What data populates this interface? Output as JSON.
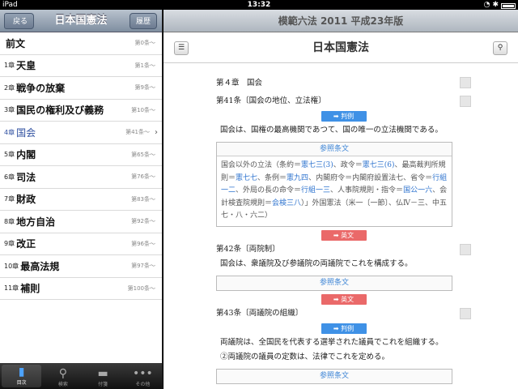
{
  "status_bar": {
    "device": "iPad",
    "time": "13:32"
  },
  "left": {
    "nav": {
      "back_label": "戻る",
      "title": "日本国憲法",
      "history_label": "履歴"
    },
    "toc": [
      {
        "num": "",
        "title": "前文",
        "article": "第0条〜",
        "selected": false
      },
      {
        "num": "1章",
        "title": "天皇",
        "article": "第1条〜",
        "selected": false
      },
      {
        "num": "2章",
        "title": "戦争の放棄",
        "article": "第9条〜",
        "selected": false
      },
      {
        "num": "3章",
        "title": "国民の権利及び義務",
        "article": "第10条〜",
        "selected": false
      },
      {
        "num": "4章",
        "title": "国会",
        "article": "第41条〜",
        "selected": true
      },
      {
        "num": "5章",
        "title": "内閣",
        "article": "第65条〜",
        "selected": false
      },
      {
        "num": "6章",
        "title": "司法",
        "article": "第76条〜",
        "selected": false
      },
      {
        "num": "7章",
        "title": "財政",
        "article": "第83条〜",
        "selected": false
      },
      {
        "num": "8章",
        "title": "地方自治",
        "article": "第92条〜",
        "selected": false
      },
      {
        "num": "9章",
        "title": "改正",
        "article": "第96条〜",
        "selected": false
      },
      {
        "num": "10章",
        "title": "最高法規",
        "article": "第97条〜",
        "selected": false
      },
      {
        "num": "11章",
        "title": "補則",
        "article": "第100条〜",
        "selected": false
      }
    ],
    "tabs": [
      {
        "label": "目次",
        "icon": "book-icon",
        "active": true
      },
      {
        "label": "検索",
        "icon": "magnifier-icon",
        "active": false
      },
      {
        "label": "付箋",
        "icon": "sticky-note-icon",
        "active": false
      },
      {
        "label": "その他",
        "icon": "more-dots-icon",
        "active": false
      }
    ]
  },
  "right": {
    "header_title": "模範六法 2011 平成23年版",
    "doc_title": "日本国憲法",
    "chapter": "第４章　国会",
    "art41": {
      "heading": "第41条〔国会の地位、立法権〕",
      "case_label": "➡ 判例",
      "text": "国会は、国権の最高機関であつて、国の唯一の立法機関である。",
      "ref_head": "参照条文",
      "ref_parts": [
        {
          "t": "国会以外の立法（条約＝",
          "l": false
        },
        {
          "t": "憲七三(3)",
          "l": true
        },
        {
          "t": "、政令＝",
          "l": false
        },
        {
          "t": "憲七三(6)",
          "l": true
        },
        {
          "t": "、最高裁判所規則＝",
          "l": false
        },
        {
          "t": "憲七七",
          "l": true
        },
        {
          "t": "、条例＝",
          "l": false
        },
        {
          "t": "憲九四",
          "l": true
        },
        {
          "t": "、内閣府令＝内閣府設置法七、省令＝",
          "l": false
        },
        {
          "t": "行組一二",
          "l": true
        },
        {
          "t": "、外局の長の命令＝",
          "l": false
        },
        {
          "t": "行組一三",
          "l": true
        },
        {
          "t": "、人事院規則・指令＝",
          "l": false
        },
        {
          "t": "国公一六",
          "l": true
        },
        {
          "t": "、会計検査院規則＝",
          "l": false
        },
        {
          "t": "会検三八",
          "l": true
        },
        {
          "t": "）」外国憲法（米一〔一節〕、仏Ⅳ－三、中五七・八・六二）",
          "l": false
        }
      ],
      "english_label": "➡ 英文"
    },
    "art42": {
      "heading": "第42条〔両院制〕",
      "text": "国会は、衆議院及び参議院の両議院でこれを構成する。",
      "ref_head": "参照条文",
      "english_label": "➡ 英文"
    },
    "art43": {
      "heading": "第43条〔両議院の組織〕",
      "case_label": "➡ 判例",
      "text1": "両議院は、全国民を代表する選挙された議員でこれを組織する。",
      "text2": "②両議院の議員の定数は、法律でこれを定める。",
      "ref_head": "参照条文"
    }
  }
}
